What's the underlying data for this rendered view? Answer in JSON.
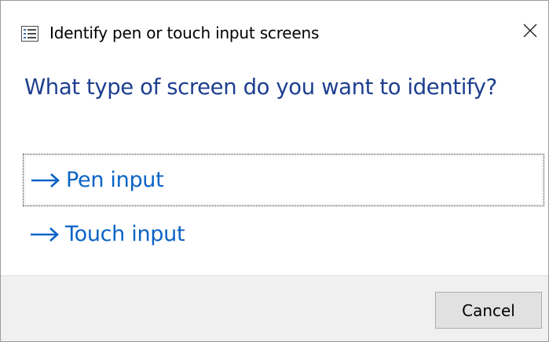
{
  "window": {
    "title": "Identify pen or touch input screens",
    "app_icon": "settings-list-icon",
    "close_icon": "close-icon"
  },
  "main": {
    "heading": "What type of screen do you want to identify?",
    "options": [
      {
        "label": "Pen input",
        "icon": "arrow-right-icon",
        "focused": true
      },
      {
        "label": "Touch input",
        "icon": "arrow-right-icon",
        "focused": false
      }
    ]
  },
  "footer": {
    "cancel_label": "Cancel"
  },
  "colors": {
    "heading": "#1e3f8f",
    "option_link": "#0b63c5",
    "footer_bg": "#f0f0f0",
    "button_bg": "#e1e1e1"
  }
}
